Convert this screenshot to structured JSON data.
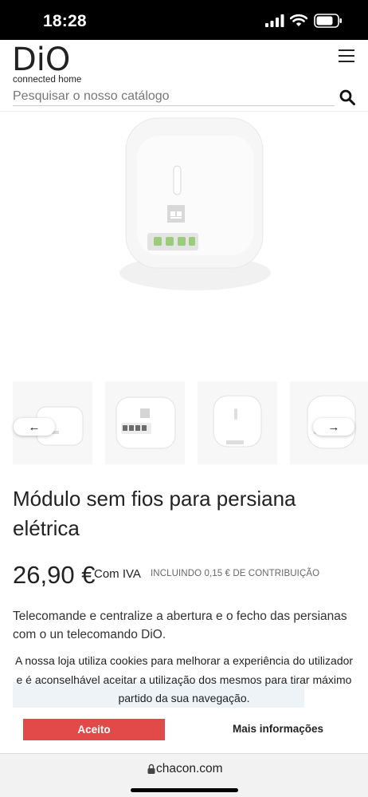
{
  "status_bar": {
    "time": "18:28"
  },
  "header": {
    "logo_text": "DiO",
    "logo_subtitle": "connected home",
    "search_placeholder": "Pesquisar o nosso catálogo",
    "menu_icon": "hamburger-menu-icon",
    "search_icon": "search-icon"
  },
  "gallery": {
    "prev_arrow": "←",
    "next_arrow": "→",
    "thumbnail_count": 4
  },
  "product": {
    "title": "Módulo sem fios para persiana elétrica",
    "price": "26,90 €",
    "tax_label": "Com IVA",
    "contribution_label": "INCLUINDO 0,15 € DE CONTRIBUIÇÃO",
    "description": "Telecomande e centralize a abertura e o fecho das persianas com o un telecomando DiO."
  },
  "cookie_banner": {
    "text": "A nossa loja utiliza cookies para melhorar a experiência do utilizador e é aconselhável aceitar a utilização dos mesmos para tirar máximo partido da sua navegação.",
    "accept_label": "Aceito",
    "more_info_label": "Mais informações",
    "accept_color": "#e24a4a"
  },
  "browser": {
    "url": "chacon.com"
  }
}
